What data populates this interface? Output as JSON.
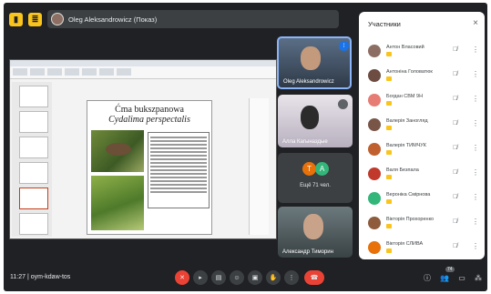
{
  "top": {
    "presenter_label": "Oleg Aleksandrowicz (Показ)"
  },
  "slide": {
    "title": "Ćma bukszpanowa",
    "subtitle": "Cydalima perspectalis"
  },
  "tiles": [
    {
      "name": "Oleg Aleksandrowicz"
    },
    {
      "name": "Алла Кагыназдые"
    },
    {
      "initials": [
        "T",
        "A"
      ],
      "name": "Ещё 71 чел."
    },
    {
      "name": "Александр Тиморин"
    }
  ],
  "bottom": {
    "time": "11:27",
    "separator": "|",
    "meeting_code": "oym-kdaw-tos",
    "participants_badge": "74"
  },
  "panel": {
    "title": "Участники",
    "close": "×",
    "participants": [
      {
        "name": "Антон Власовий",
        "color": "#8d6e63"
      },
      {
        "name": "Антоніна Головатюк",
        "color": "#6d4c41"
      },
      {
        "name": "Богдан СВМ 9Н",
        "color": "#e67c73"
      },
      {
        "name": "Валерія Заногляд",
        "color": "#795548"
      },
      {
        "name": "Валерія ТИМЧУК",
        "color": "#c0602e"
      },
      {
        "name": "Валя Безпала",
        "color": "#c0392b"
      },
      {
        "name": "Вероніка Смірнова",
        "color": "#33b679"
      },
      {
        "name": "Вікторія Прохоренко",
        "color": "#8e5b3c"
      },
      {
        "name": "Вікторія СЛИВА",
        "color": "#e8710a"
      }
    ]
  }
}
